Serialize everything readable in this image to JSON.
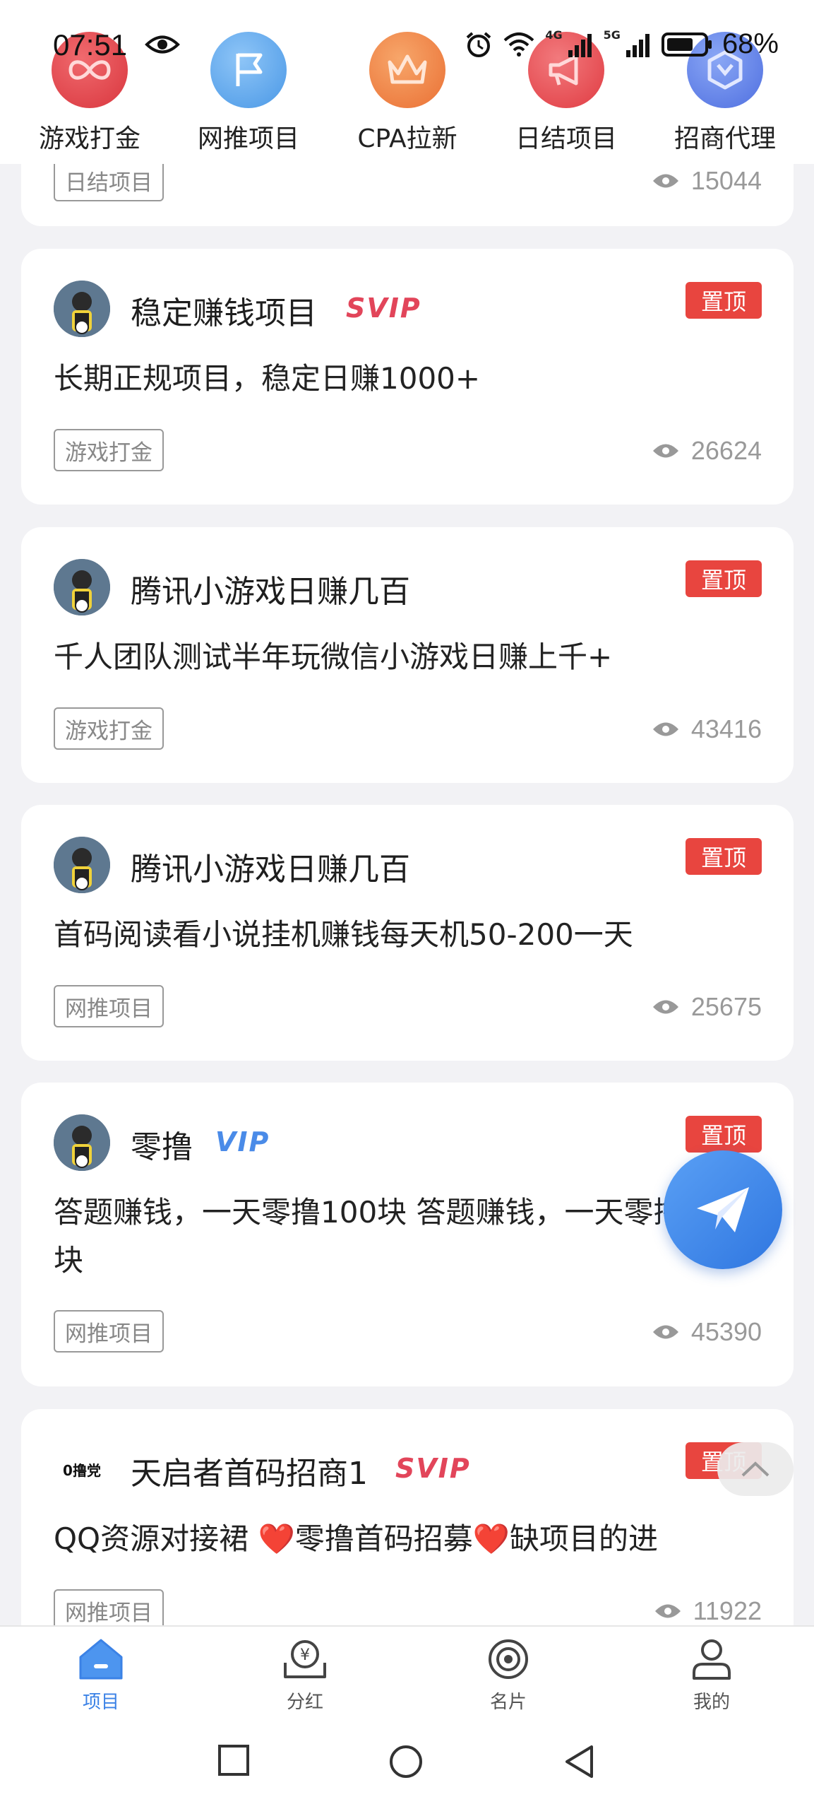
{
  "status_bar": {
    "time": "07:51",
    "network": "4G",
    "network2": "5G",
    "battery": "68%"
  },
  "categories": [
    {
      "label": "游戏打金",
      "icon": "infinity-icon",
      "color": "#e5474e"
    },
    {
      "label": "网推项目",
      "icon": "flag-icon",
      "color": "#5aa6ee"
    },
    {
      "label": "CPA拉新",
      "icon": "crown-icon",
      "color": "#f0884a"
    },
    {
      "label": "日结项目",
      "icon": "megaphone-icon",
      "color": "#ea4f54"
    },
    {
      "label": "招商代理",
      "icon": "hexagon-icon",
      "color": "#5a7ee8"
    }
  ],
  "partial_card": {
    "tag": "日结项目",
    "views": "15044"
  },
  "posts": [
    {
      "name": "稳定赚钱项目",
      "badge": "SVIP",
      "pin": "置顶",
      "desc": "长期正规项目，稳定日赚1000+",
      "tag": "游戏打金",
      "views": "26624"
    },
    {
      "name": "腾讯小游戏日赚几百",
      "badge": "",
      "pin": "置顶",
      "desc": "千人团队测试半年玩微信小游戏日赚上千+",
      "tag": "游戏打金",
      "views": "43416"
    },
    {
      "name": "腾讯小游戏日赚几百",
      "badge": "",
      "pin": "置顶",
      "desc": "首码阅读看小说挂机赚钱每天机50-200一天",
      "tag": "网推项目",
      "views": "25675"
    },
    {
      "name": "零撸",
      "badge": "VIP",
      "pin": "置顶",
      "desc": "答题赚钱，一天零撸100块 答题赚钱，一天零撸100块",
      "tag": "网推项目",
      "views": "45390"
    },
    {
      "name": "天启者首码招商1",
      "badge": "SVIP",
      "pin": "置顶",
      "desc": "QQ资源对接裙 ❤️零撸首码招募❤️缺项目的进",
      "tag": "网推项目",
      "views": "11922"
    }
  ],
  "avatar_logo_text": "0撸党",
  "bottom_nav": [
    {
      "label": "项目",
      "icon": "home-icon",
      "active": true
    },
    {
      "label": "分红",
      "icon": "yuan-wallet-icon",
      "active": false
    },
    {
      "label": "名片",
      "icon": "target-icon",
      "active": false
    },
    {
      "label": "我的",
      "icon": "user-icon",
      "active": false
    }
  ],
  "colors": {
    "accent": "#3b82e6",
    "pin": "#e8453f",
    "svip": "#e2455a",
    "vip": "#4a8be8"
  }
}
